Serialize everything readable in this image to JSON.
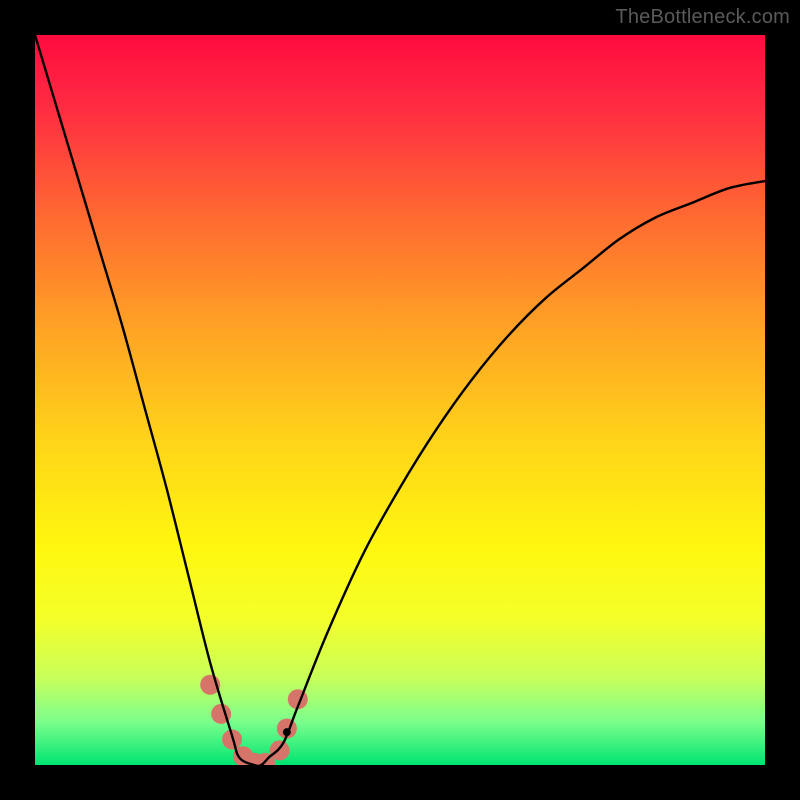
{
  "watermark": "TheBottleneck.com",
  "chart_data": {
    "type": "line",
    "title": "",
    "xlabel": "",
    "ylabel": "",
    "xlim": [
      0,
      100
    ],
    "ylim": [
      0,
      100
    ],
    "legend": false,
    "grid": false,
    "background": {
      "type": "vertical-gradient",
      "stops": [
        {
          "pos": 0.0,
          "color": "#ff0b3f"
        },
        {
          "pos": 0.1,
          "color": "#ff2c42"
        },
        {
          "pos": 0.25,
          "color": "#ff6a31"
        },
        {
          "pos": 0.4,
          "color": "#ffa225"
        },
        {
          "pos": 0.55,
          "color": "#ffd21a"
        },
        {
          "pos": 0.7,
          "color": "#fff70f"
        },
        {
          "pos": 0.8,
          "color": "#f4ff2a"
        },
        {
          "pos": 0.88,
          "color": "#c8ff5a"
        },
        {
          "pos": 0.94,
          "color": "#7dff8c"
        },
        {
          "pos": 1.0,
          "color": "#00e472"
        }
      ]
    },
    "series": [
      {
        "name": "bottleneck-curve",
        "color": "#000000",
        "stroke_width": 2.4,
        "x": [
          0,
          3,
          6,
          9,
          12,
          15,
          18,
          21,
          24,
          27,
          28,
          30,
          31,
          32,
          34,
          36,
          40,
          45,
          50,
          55,
          60,
          65,
          70,
          75,
          80,
          85,
          90,
          95,
          100
        ],
        "values": [
          100,
          90,
          80,
          70,
          60,
          49,
          38,
          26,
          14,
          4,
          1,
          0,
          0,
          1,
          3,
          8,
          18,
          29,
          38,
          46,
          53,
          59,
          64,
          68,
          72,
          75,
          77,
          79,
          80
        ]
      }
    ],
    "markers": [
      {
        "name": "highlight-dot",
        "x": 24.0,
        "y": 11.0,
        "r": 10,
        "color": "#d6746a"
      },
      {
        "name": "highlight-dot",
        "x": 25.5,
        "y": 7.0,
        "r": 10,
        "color": "#d6746a"
      },
      {
        "name": "highlight-dot",
        "x": 27.0,
        "y": 3.5,
        "r": 10,
        "color": "#d6746a"
      },
      {
        "name": "highlight-dot",
        "x": 28.5,
        "y": 1.2,
        "r": 10,
        "color": "#d6746a"
      },
      {
        "name": "highlight-dot",
        "x": 30.0,
        "y": 0.3,
        "r": 10,
        "color": "#d6746a"
      },
      {
        "name": "highlight-dot",
        "x": 31.5,
        "y": 0.3,
        "r": 10,
        "color": "#d6746a"
      },
      {
        "name": "highlight-dot",
        "x": 33.5,
        "y": 2.0,
        "r": 10,
        "color": "#d6746a"
      },
      {
        "name": "highlight-dot",
        "x": 34.5,
        "y": 5.0,
        "r": 10,
        "color": "#d6746a"
      },
      {
        "name": "highlight-dot",
        "x": 36.0,
        "y": 9.0,
        "r": 10,
        "color": "#d6746a"
      },
      {
        "name": "curve-point",
        "x": 34.5,
        "y": 4.5,
        "r": 4,
        "color": "#000000"
      }
    ]
  }
}
